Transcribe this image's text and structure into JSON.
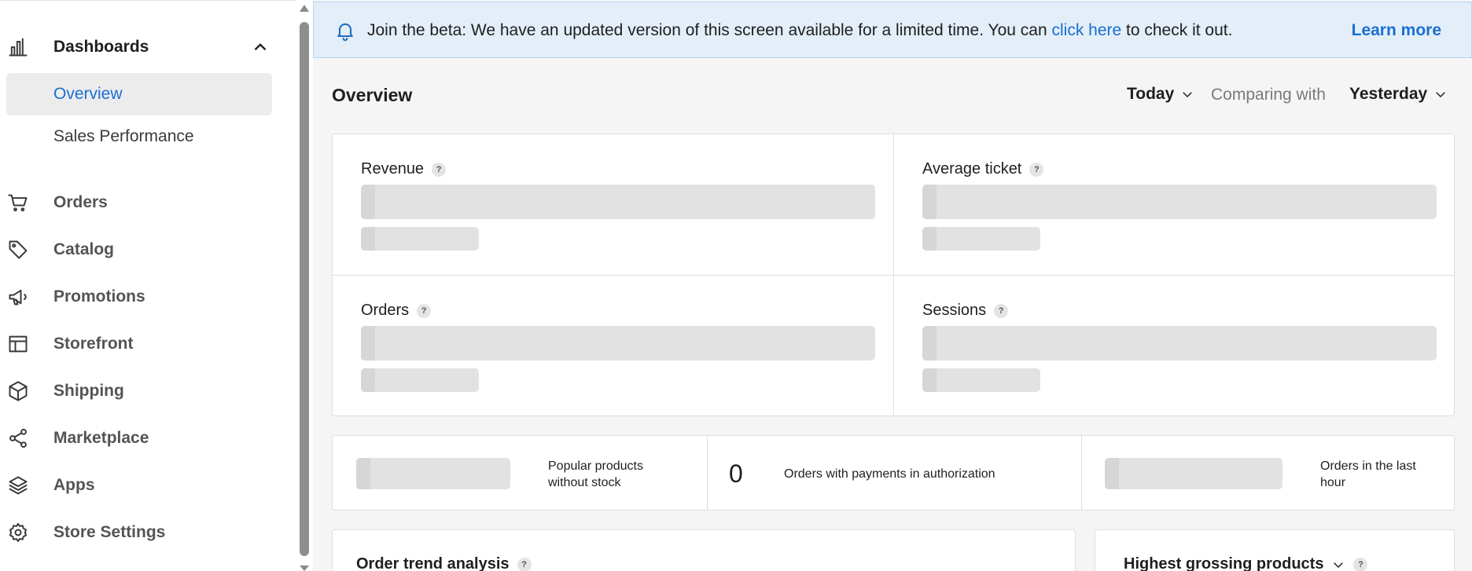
{
  "sidebar": {
    "group": {
      "label": "Dashboards",
      "icon": "bar-chart-icon"
    },
    "sub_items": [
      {
        "label": "Overview",
        "active": true
      },
      {
        "label": "Sales Performance",
        "active": false
      }
    ],
    "items": [
      {
        "label": "Orders",
        "icon": "cart-icon"
      },
      {
        "label": "Catalog",
        "icon": "tag-icon"
      },
      {
        "label": "Promotions",
        "icon": "megaphone-icon"
      },
      {
        "label": "Storefront",
        "icon": "layout-icon"
      },
      {
        "label": "Shipping",
        "icon": "box-icon"
      },
      {
        "label": "Marketplace",
        "icon": "share-icon"
      },
      {
        "label": "Apps",
        "icon": "layers-icon"
      },
      {
        "label": "Store Settings",
        "icon": "gear-icon"
      }
    ]
  },
  "banner": {
    "text_before": "Join the beta: We have an updated version of this screen available for a limited time. You can ",
    "link": "click here",
    "text_after": " to check it out.",
    "learn_more": "Learn more",
    "icon": "bell-icon"
  },
  "header": {
    "title": "Overview",
    "period": "Today",
    "comparing_label": "Comparing with",
    "compare_period": "Yesterday"
  },
  "metrics": [
    {
      "label": "Revenue",
      "help": "?"
    },
    {
      "label": "Average ticket",
      "help": "?"
    },
    {
      "label": "Orders",
      "help": "?"
    },
    {
      "label": "Sessions",
      "help": "?"
    }
  ],
  "stats": {
    "popular_without_stock": "Popular products without stock",
    "payments_in_authorization_value": "0",
    "payments_in_authorization": "Orders with payments in authorization",
    "orders_last_hour": "Orders in the last hour"
  },
  "bottom": {
    "order_trend": "Order trend analysis",
    "highest_grossing": "Highest grossing products",
    "help": "?"
  },
  "colors": {
    "accent": "#1a6fd1",
    "banner_bg": "#e3eef8",
    "skeleton": "#e2e2e2"
  }
}
